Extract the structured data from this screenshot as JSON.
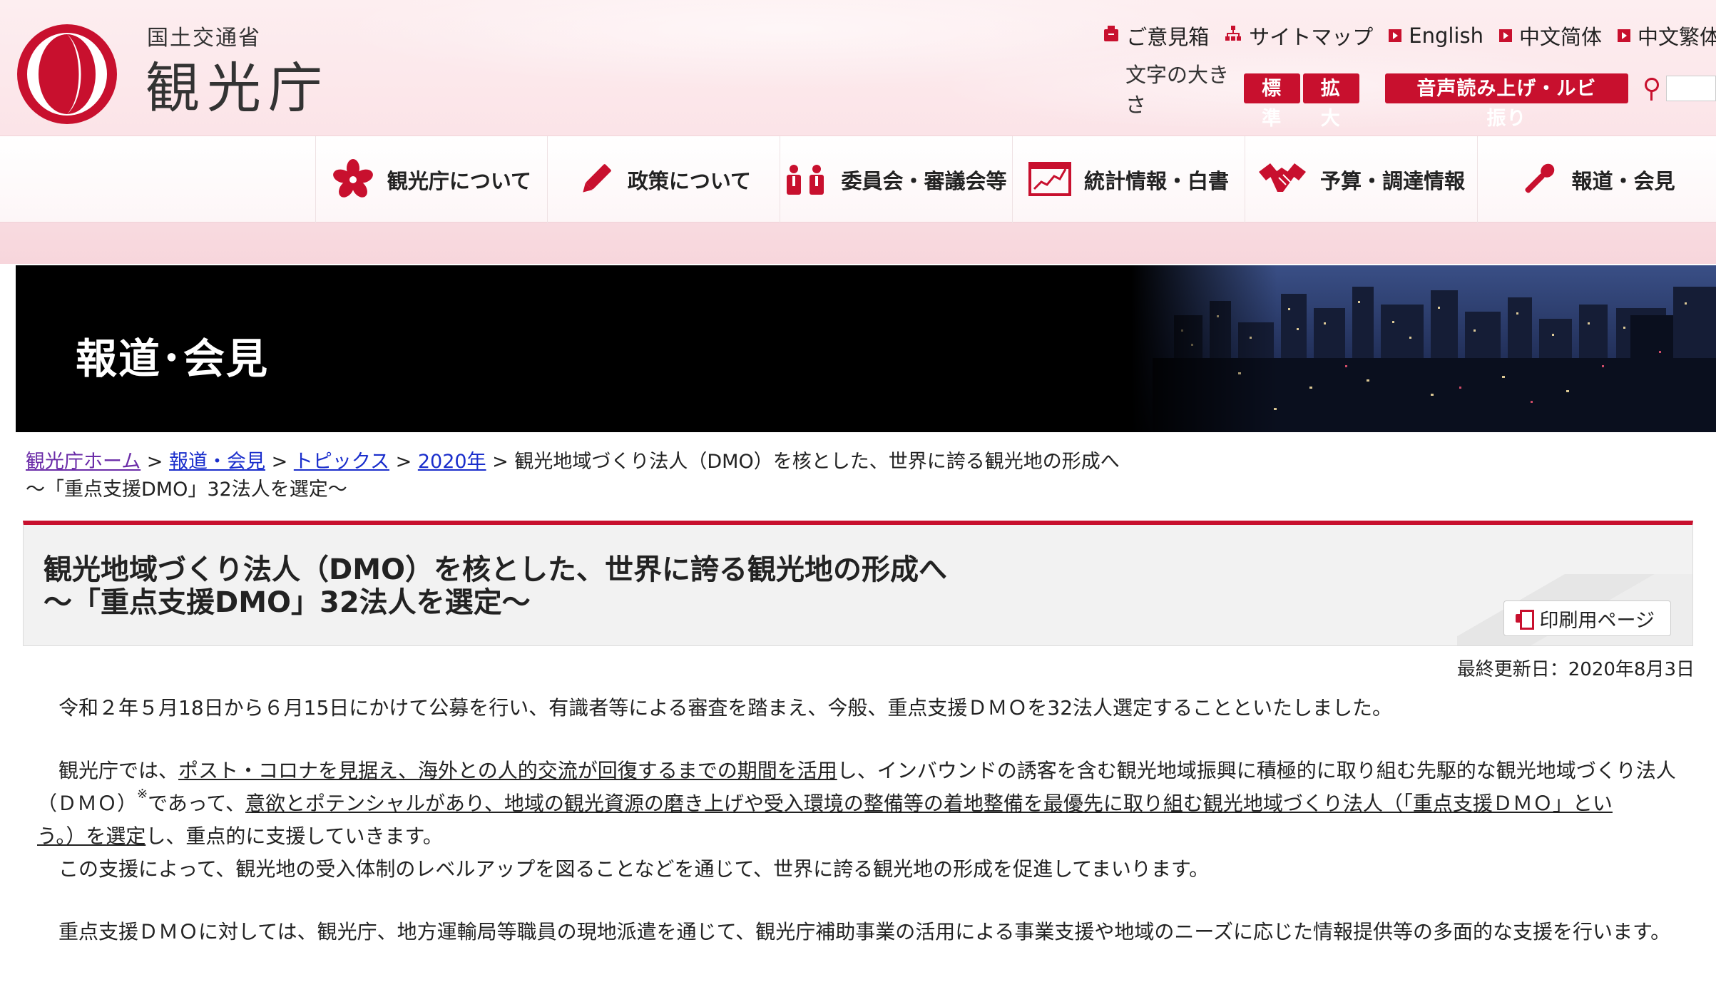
{
  "header": {
    "ministry": "国土交通省",
    "agency": "観光庁",
    "utility_links": [
      {
        "label": "ご意見箱",
        "icon": "mailbox-icon"
      },
      {
        "label": "サイトマップ",
        "icon": "sitemap-icon"
      },
      {
        "label": "English",
        "icon": "arrow-square-icon"
      },
      {
        "label": "中文简体",
        "icon": "arrow-square-icon"
      },
      {
        "label": "中文繁体",
        "icon": "arrow-square-icon"
      }
    ],
    "font_size_label": "文字の大きさ",
    "font_standard": "標準",
    "font_large": "拡大",
    "voice_button": "音声読み上げ・ルビ振り",
    "accent_color": "#c8102e"
  },
  "nav": {
    "items": [
      {
        "label": "観光庁について",
        "icon": "sakura-icon"
      },
      {
        "label": "政策について",
        "icon": "pencil-icon"
      },
      {
        "label": "委員会・審議会等",
        "icon": "people-icon"
      },
      {
        "label": "統計情報・白書",
        "icon": "chart-icon"
      },
      {
        "label": "予算・調達情報",
        "icon": "handshake-icon"
      },
      {
        "label": "報道・会見",
        "icon": "microphone-icon"
      }
    ]
  },
  "banner": {
    "title": "報道･会見"
  },
  "breadcrumb": {
    "items": [
      "観光庁ホーム",
      "報道・会見",
      "トピックス",
      "2020年"
    ],
    "separator": ">",
    "current_line1": "観光地域づくり法人（DMO）を核とした、世界に誇る観光地の形成へ",
    "current_line2": "〜「重点支援DMO」32法人を選定〜"
  },
  "article": {
    "title_line1": "観光地域づくり法人（DMO）を核とした、世界に誇る観光地の形成へ",
    "title_line2": "〜「重点支援DMO」32法人を選定〜",
    "print_label": "印刷用ページ",
    "updated": "最終更新日：2020年8月3日",
    "p1": "令和２年５月18日から６月15日にかけて公募を行い、有識者等による審査を踏まえ、今般、重点支援ＤＭＯを32法人選定することといたしました。",
    "p2_a": "観光庁では、",
    "p2_u1": "ポスト・コロナを見据え、海外との人的交流が回復するまでの期間を活用",
    "p2_b": "し、インバウンドの誘客を含む観光地域振興に積極的に取り組む先駆的な観光地域づくり法人",
    "p2_c": "（ＤＭＯ）",
    "p2_sup": "※",
    "p2_d": "であって、",
    "p2_u2": "意欲とポテンシャルがあり、地域の観光資源の磨き上げや受入環境の整備等の着地整備を最優先に取り組む観光地域づくり法人（「重点支援ＤＭＯ」とい",
    "p2_u3": "う。）を選定",
    "p2_e": "し、重点的に支援していきます。",
    "p3": "この支援によって、観光地の受入体制のレベルアップを図ることなどを通じて、世界に誇る観光地の形成を促進してまいります。",
    "p4": "重点支援ＤＭＯに対しては、観光庁、地方運輸局等職員の現地派遣を通じて、観光庁補助事業の活用による事業支援や地域のニーズに応じた情報提供等の多面的な支援を行います。"
  }
}
